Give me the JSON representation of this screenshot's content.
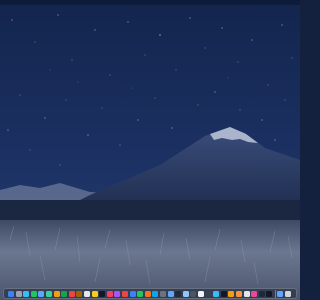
{
  "wallpaper": {
    "sky_color": "#1a2d5a",
    "mountain_color": "#2e3f66",
    "grass_color": "#4a5568"
  },
  "dock": {
    "apps": [
      {
        "name": "finder-icon",
        "color": "#3b82f6"
      },
      {
        "name": "launchpad-icon",
        "color": "#9ca3af"
      },
      {
        "name": "safari-icon",
        "color": "#38bdf8"
      },
      {
        "name": "messages-icon",
        "color": "#22c55e"
      },
      {
        "name": "mail-icon",
        "color": "#60a5fa"
      },
      {
        "name": "maps-icon",
        "color": "#34d399"
      },
      {
        "name": "photos-icon",
        "color": "#f59e0b"
      },
      {
        "name": "facetime-icon",
        "color": "#16a34a"
      },
      {
        "name": "calendar-icon",
        "color": "#ef4444"
      },
      {
        "name": "contacts-icon",
        "color": "#a16207"
      },
      {
        "name": "reminders-icon",
        "color": "#e5e7eb"
      },
      {
        "name": "notes-icon",
        "color": "#facc15"
      },
      {
        "name": "tv-icon",
        "color": "#111827"
      },
      {
        "name": "music-icon",
        "color": "#f43f5e"
      },
      {
        "name": "podcasts-icon",
        "color": "#a855f7"
      },
      {
        "name": "news-icon",
        "color": "#ef4444"
      },
      {
        "name": "keynote-icon",
        "color": "#3b82f6"
      },
      {
        "name": "numbers-icon",
        "color": "#22c55e"
      },
      {
        "name": "pages-icon",
        "color": "#f97316"
      },
      {
        "name": "app-store-icon",
        "color": "#0ea5e9"
      },
      {
        "name": "system-settings-icon",
        "color": "#6b7280"
      },
      {
        "name": "xcode-icon",
        "color": "#60a5fa"
      },
      {
        "name": "terminal-icon",
        "color": "#1f2937"
      },
      {
        "name": "preview-icon",
        "color": "#93c5fd"
      },
      {
        "name": "activity-monitor-icon",
        "color": "#4b5563"
      },
      {
        "name": "textedit-icon",
        "color": "#f3f4f6"
      },
      {
        "name": "calculator-icon",
        "color": "#374151"
      },
      {
        "name": "weather-icon",
        "color": "#38bdf8"
      },
      {
        "name": "stocks-icon",
        "color": "#111827"
      },
      {
        "name": "home-icon",
        "color": "#f59e0b"
      },
      {
        "name": "books-icon",
        "color": "#fb923c"
      },
      {
        "name": "freeform-icon",
        "color": "#e5e7eb"
      },
      {
        "name": "shortcuts-icon",
        "color": "#ec4899"
      },
      {
        "name": "voice-memos-icon",
        "color": "#1f2937"
      },
      {
        "name": "clock-icon",
        "color": "#111827"
      }
    ],
    "trailing": [
      {
        "name": "downloads-folder-icon",
        "color": "#60a5fa"
      },
      {
        "name": "trash-icon",
        "color": "#d1d5db"
      }
    ]
  }
}
